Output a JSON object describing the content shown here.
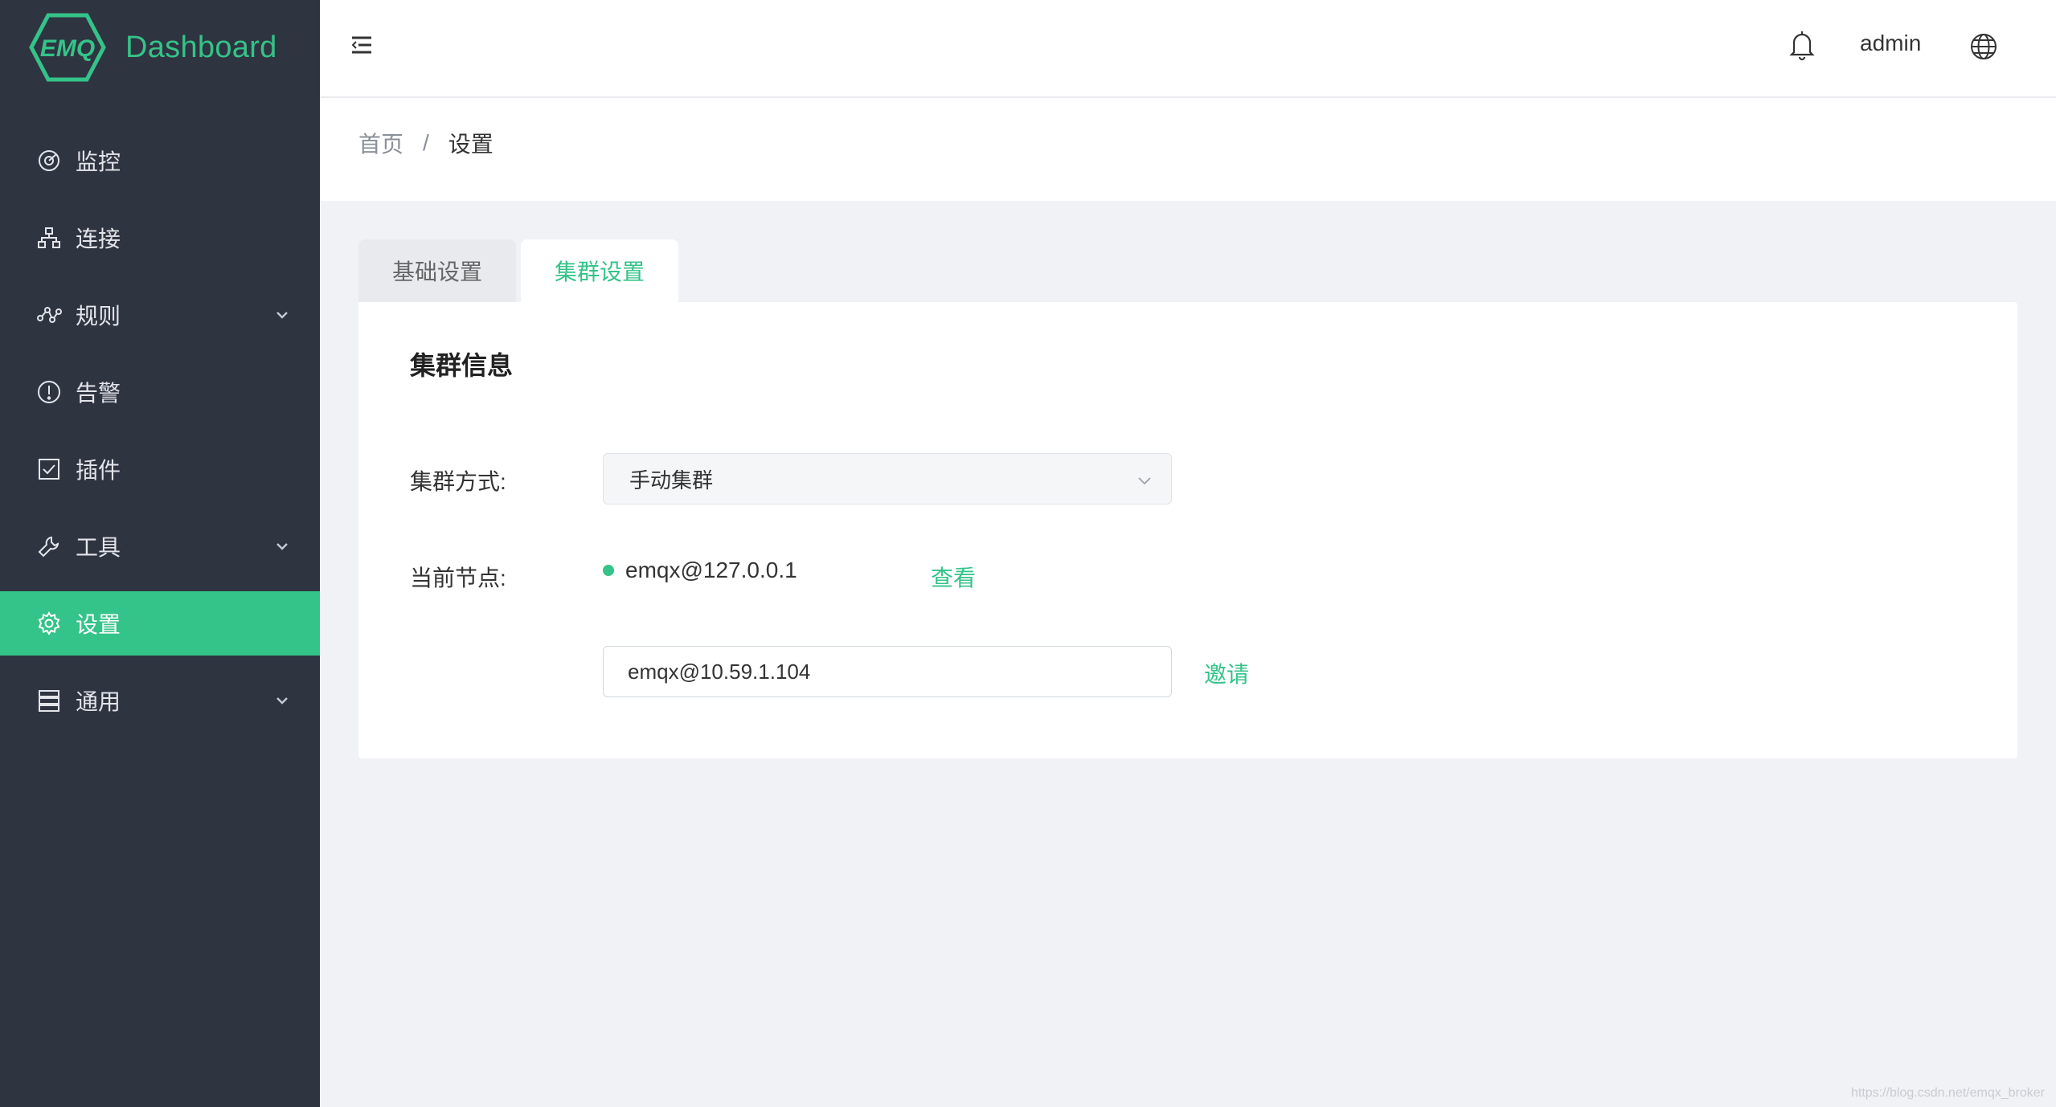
{
  "brand": {
    "logo_text": "EMQ",
    "app_title": "Dashboard",
    "accent_color": "#34c388",
    "sidebar_bg": "#2f3441"
  },
  "sidebar": {
    "items": [
      {
        "label": "监控",
        "icon": "monitor-icon",
        "expandable": false,
        "active": false
      },
      {
        "label": "连接",
        "icon": "network-icon",
        "expandable": false,
        "active": false
      },
      {
        "label": "规则",
        "icon": "rule-flow-icon",
        "expandable": true,
        "active": false
      },
      {
        "label": "告警",
        "icon": "alert-circle-icon",
        "expandable": false,
        "active": false
      },
      {
        "label": "插件",
        "icon": "checkbox-icon",
        "expandable": false,
        "active": false
      },
      {
        "label": "工具",
        "icon": "wrench-icon",
        "expandable": true,
        "active": false
      },
      {
        "label": "设置",
        "icon": "gear-icon",
        "expandable": false,
        "active": true
      },
      {
        "label": "通用",
        "icon": "server-icon",
        "expandable": true,
        "active": false
      }
    ]
  },
  "header": {
    "menu_icon": "hamburger-icon",
    "notification_icon": "bell-icon",
    "user": "admin",
    "language_icon": "globe-icon"
  },
  "breadcrumb": {
    "home": "首页",
    "separator": "/",
    "current": "设置"
  },
  "tabs": [
    {
      "label": "基础设置",
      "active": false
    },
    {
      "label": "集群设置",
      "active": true
    }
  ],
  "cluster": {
    "title": "集群信息",
    "mode_label": "集群方式:",
    "mode_value": "手动集群",
    "current_node_label": "当前节点:",
    "current_node": "emqx@127.0.0.1",
    "view_link": "查看",
    "invite_input_value": "emqx@10.59.1.104",
    "invite_link": "邀请"
  },
  "watermark": "https://blog.csdn.net/emqx_broker"
}
